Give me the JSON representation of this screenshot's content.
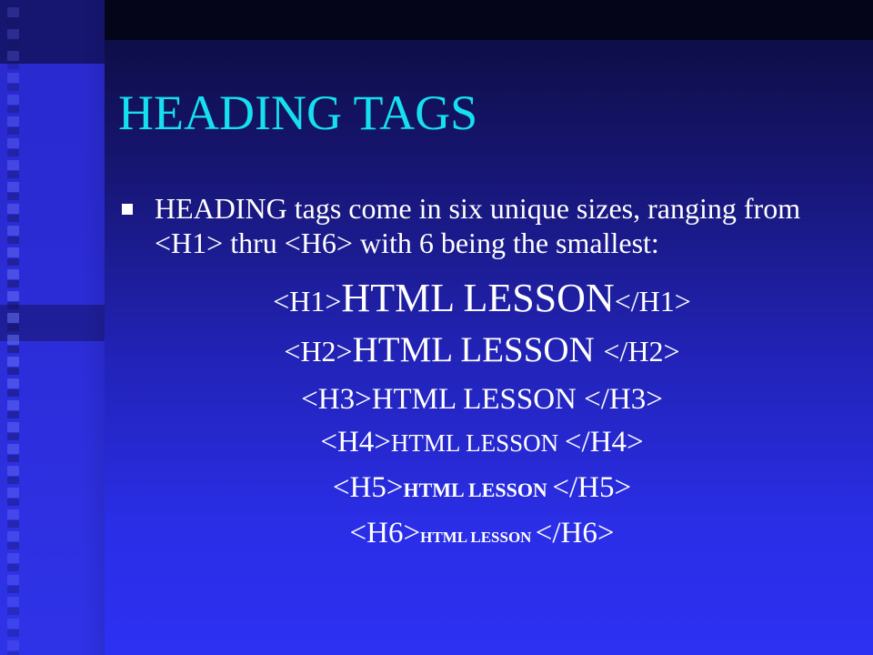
{
  "slide": {
    "title": "HEADING TAGS",
    "bullet": {
      "text": "HEADING tags come in six unique sizes, ranging from <H1> thru <H6> with 6 being the smallest:"
    },
    "headings": [
      {
        "open": "<H1>",
        "text": "HTML LESSON",
        "close": "</H1>"
      },
      {
        "open": "<H2>",
        "text": "HTML LESSON ",
        "close": "</H2>"
      },
      {
        "open": "<H3>",
        "text": "HTML LESSON ",
        "close": "</H3>"
      },
      {
        "open": "<H4>",
        "text": "HTML LESSON ",
        "close": "</H4>"
      },
      {
        "open": "<H5>",
        "text": "HTML LESSON ",
        "close": "</H5>"
      },
      {
        "open": "<H6>",
        "text": "HTML LESSON ",
        "close": "</H6>"
      }
    ]
  },
  "colors": {
    "title": "#16e0f0",
    "body_text": "#ffffff",
    "background_top": "#0b0b3a",
    "background_bottom": "#2d31f2",
    "left_strip": "#2b2bd4"
  },
  "icons": {
    "bullet": "square-bullet-icon"
  }
}
